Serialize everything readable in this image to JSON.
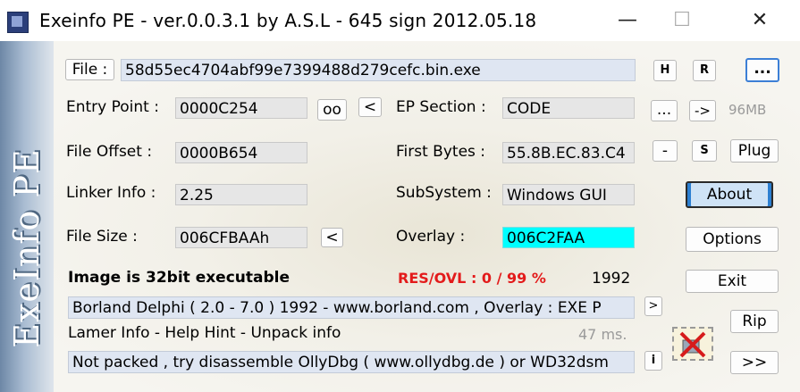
{
  "window": {
    "title": "Exeinfo PE - ver.0.0.3.1  by A.S.L -  645 sign 2012.05.18",
    "minimize_glyph": "—",
    "maximize_glyph": "☐",
    "close_glyph": "✕"
  },
  "logo": {
    "text": "ExeInfo PE"
  },
  "file": {
    "button_label": "File :",
    "value": "58d55ec4704abf99e7399488d279cefc.bin.exe"
  },
  "toolbar": {
    "h_label": "H",
    "r_label": "R",
    "browse_label": "..."
  },
  "entry_point": {
    "label": "Entry Point :",
    "value": "0000C254",
    "oo_label": "oo",
    "lt_label": "<"
  },
  "ep_section": {
    "label": "EP Section :",
    "value": "CODE",
    "dots_label": "...",
    "arrow_label": "->",
    "size_label": "96MB"
  },
  "file_offset": {
    "label": "File Offset :",
    "value": "0000B654"
  },
  "first_bytes": {
    "label": "First Bytes :",
    "value": "55.8B.EC.83.C4",
    "minus_label": "-",
    "s_label": "S",
    "plug_label": "Plug"
  },
  "linker_info": {
    "label": "Linker Info :",
    "value": "2.25"
  },
  "subsystem": {
    "label": "SubSystem :",
    "value": "Windows GUI"
  },
  "about_label": "About",
  "file_size": {
    "label": "File Size :",
    "value": "006CFBAAh",
    "lt_label": "<"
  },
  "overlay": {
    "label": "Overlay :",
    "value": "006C2FAA"
  },
  "options_label": "Options",
  "image_info": "Image is 32bit executable",
  "res_ovl": "RES/OVL : 0 / 99 %",
  "year": "1992",
  "exit_label": "Exit",
  "detect": {
    "value": "Borland Delphi ( 2.0 - 7.0 ) 1992 - www.borland.com , Overlay :  EXE P",
    "gt_label": ">"
  },
  "rip_label": "Rip",
  "lamer_info": "Lamer Info - Help Hint - Unpack info",
  "timing": "47 ms.",
  "hint": {
    "value": "Not packed , try disassemble OllyDbg ( www.ollydbg.de ) or  WD32dsm",
    "i_label": "i"
  },
  "next_label": ">>",
  "colors": {
    "overlay_bg": "#00ffff",
    "res_ovl": "#e31b1b",
    "about_accent": "#2c7fd1"
  }
}
